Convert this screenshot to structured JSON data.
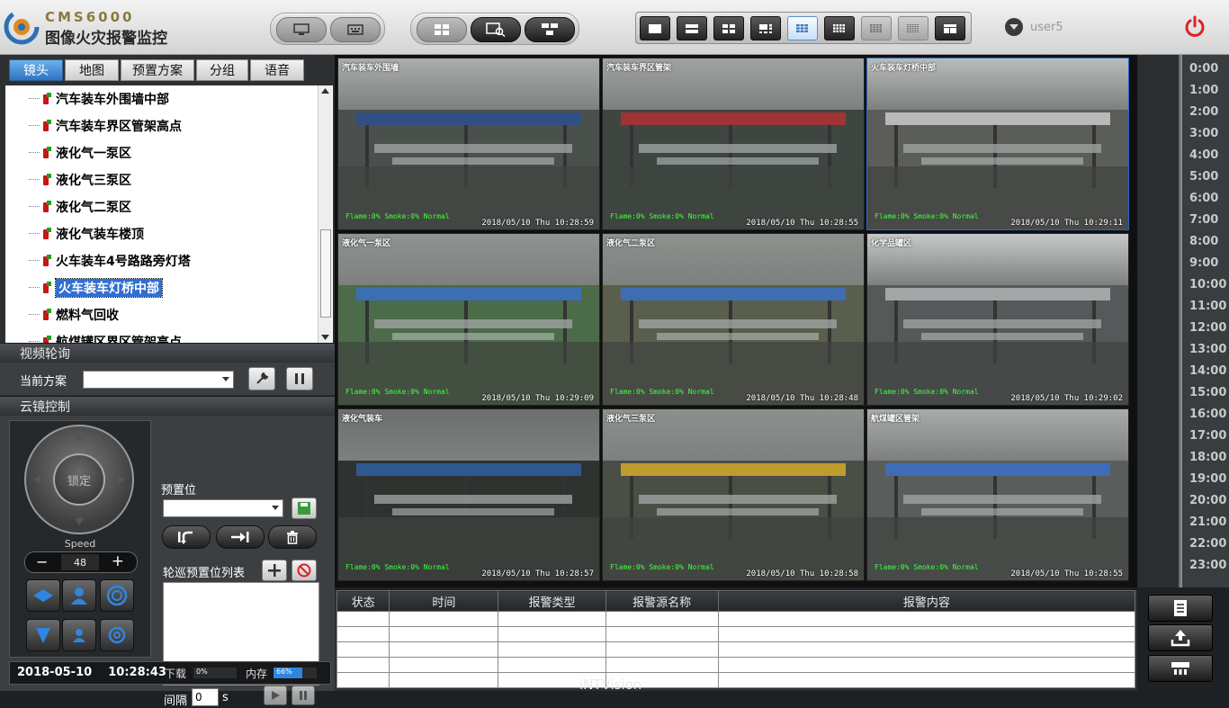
{
  "app": {
    "logo_title": "CMS6000",
    "logo_subtitle": "图像火灾报警监控",
    "user": "user5",
    "brand": "iNTVision"
  },
  "toolbar": {
    "left_icons": [
      "monitor-icon",
      "keyboard-icon"
    ],
    "mid_icons": [
      "window-layout-icon",
      "video-search-icon",
      "device-tree-icon"
    ],
    "layouts": [
      {
        "name": "layout-1",
        "active": false
      },
      {
        "name": "layout-2",
        "active": false
      },
      {
        "name": "layout-4",
        "active": false
      },
      {
        "name": "layout-6",
        "active": false
      },
      {
        "name": "layout-9",
        "active": true
      },
      {
        "name": "layout-12",
        "active": false
      },
      {
        "name": "layout-16",
        "active": false
      },
      {
        "name": "layout-25",
        "active": false
      },
      {
        "name": "layout-custom",
        "active": false
      }
    ]
  },
  "left": {
    "tabs": [
      "镜头",
      "地图",
      "预置方案",
      "分组",
      "语音"
    ],
    "active_tab": 0,
    "tree": [
      "汽车装车外围墙中部",
      "汽车装车界区管架高点",
      "液化气一泵区",
      "液化气三泵区",
      "液化气二泵区",
      "液化气装车楼顶",
      "火车装车4号路路旁灯塔",
      "火车装车灯桥中部",
      "燃料气回收",
      "航煤罐区界区管架高点"
    ],
    "selected_index": 7,
    "tour": {
      "header": "视频轮询",
      "plan_label": "当前方案",
      "plan_value": ""
    },
    "ptz": {
      "header": "云镜控制",
      "lock_label": "锁定",
      "speed_label": "Speed",
      "speed_value": "48",
      "minus": "−",
      "plus": "+",
      "preset_label": "预置位",
      "preset_value": "",
      "preset_list_label": "轮巡预置位列表",
      "interval_label": "间隔",
      "interval_value": "0",
      "interval_unit": "s"
    },
    "status": {
      "datetime": "2018-05-10    10:28:43",
      "download_label": "下载",
      "download_pct": "0%",
      "download_fraction": 0,
      "memory_label": "内存",
      "memory_pct": "66%",
      "memory_fraction": 0.66
    }
  },
  "video": {
    "cells": [
      {
        "title": "汽车装车外围墙",
        "status": "Flame:0% Smoke:0% Normal",
        "time": "2018/05/10 Thu 10:28:59"
      },
      {
        "title": "汽车装车界区管架",
        "status": "Flame:0% Smoke:0% Normal",
        "time": "2018/05/10 Thu 10:28:55"
      },
      {
        "title": "火车装车灯桥中部",
        "status": "Flame:0% Smoke:0% Normal",
        "time": "2018/05/10 Thu 10:29:11"
      },
      {
        "title": "液化气一泵区",
        "status": "Flame:0% Smoke:0% Normal",
        "time": "2018/05/10 Thu 10:29:09"
      },
      {
        "title": "液化气二泵区",
        "status": "Flame:0% Smoke:0% Normal",
        "time": "2018/05/10 Thu 10:28:48"
      },
      {
        "title": "化学品罐区",
        "status": "Flame:0% Smoke:0% Normal",
        "time": "2018/05/10 Thu 10:29:02"
      },
      {
        "title": "液化气装车",
        "status": "Flame:0% Smoke:0% Normal",
        "time": "2018/05/10 Thu 10:28:57"
      },
      {
        "title": "液化气三泵区",
        "status": "Flame:0% Smoke:0% Normal",
        "time": "2018/05/10 Thu 10:28:58"
      },
      {
        "title": "航煤罐区管架",
        "status": "Flame:0% Smoke:0% Normal",
        "time": "2018/05/10 Thu 10:28:55"
      }
    ]
  },
  "timeline": {
    "hours": [
      "0:00",
      "1:00",
      "2:00",
      "3:00",
      "4:00",
      "5:00",
      "6:00",
      "7:00",
      "8:00",
      "9:00",
      "10:00",
      "11:00",
      "12:00",
      "13:00",
      "14:00",
      "15:00",
      "16:00",
      "17:00",
      "18:00",
      "19:00",
      "20:00",
      "21:00",
      "22:00",
      "23:00"
    ]
  },
  "alarm": {
    "columns": [
      "状态",
      "时间",
      "报警类型",
      "报警源名称",
      "报警内容"
    ],
    "rows": 5
  },
  "side_buttons": [
    "report-icon",
    "export-icon",
    "network-icon"
  ]
}
